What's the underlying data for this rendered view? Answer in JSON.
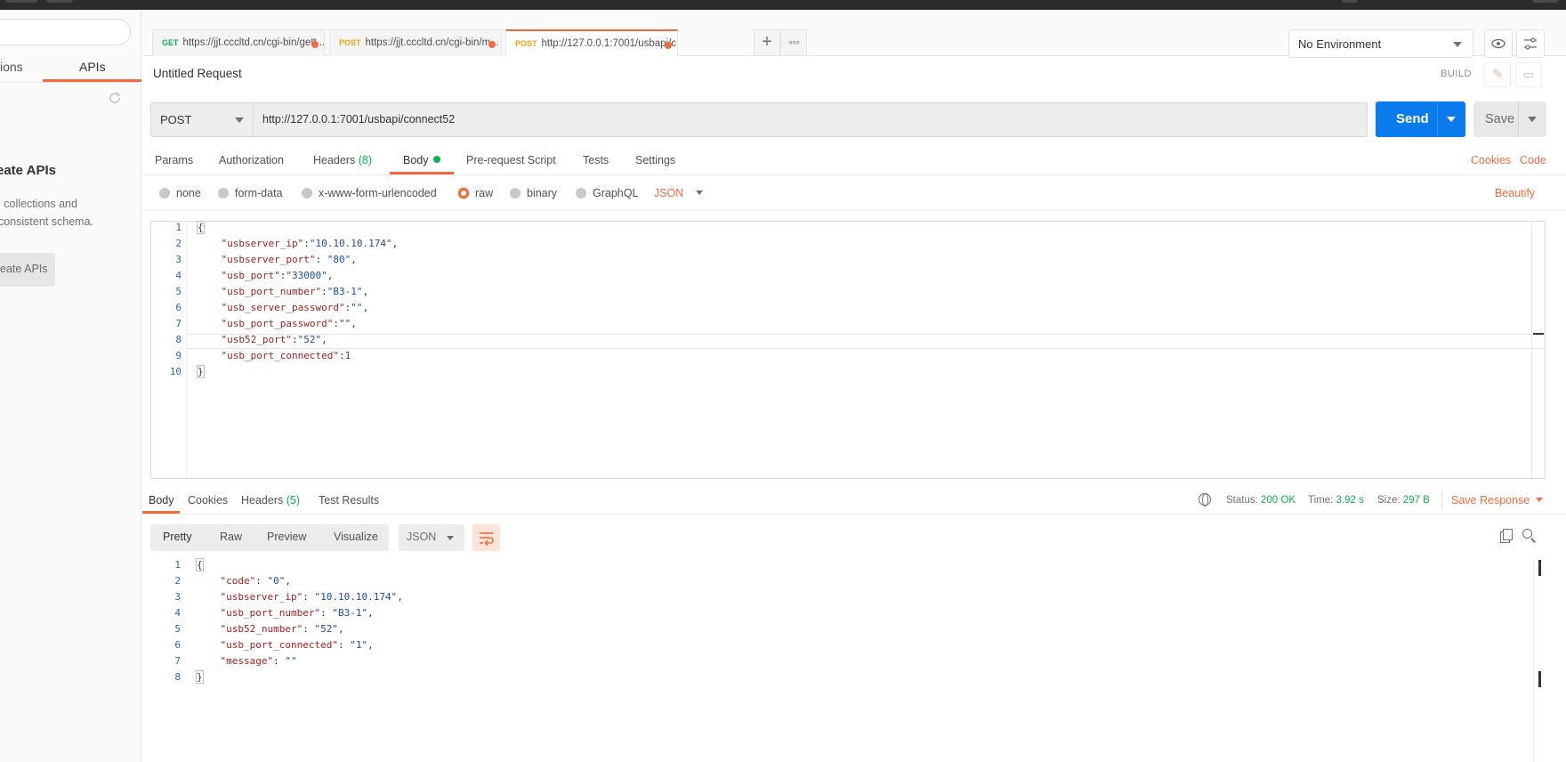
{
  "sidebar": {
    "tab_collections": "ions",
    "tab_apis": "APIs",
    "heading": "eate APIs",
    "desc_line1": "l collections and",
    "desc_line2": "consistent schema.",
    "button": "eate APIs"
  },
  "tabs": [
    {
      "method": "GET",
      "url": "https://jjt.cccltd.cn/cgi-bin/gett..."
    },
    {
      "method": "POST",
      "url": "https://jjt.cccltd.cn/cgi-bin/m..."
    },
    {
      "method": "POST",
      "url": "http://127.0.0.1:7001/usbapi/c..."
    }
  ],
  "environment": "No Environment",
  "request": {
    "title": "Untitled Request",
    "build_label": "BUILD",
    "method": "POST",
    "url": "http://127.0.0.1:7001/usbapi/connect52",
    "send_label": "Send",
    "save_label": "Save"
  },
  "request_tabs": {
    "params": "Params",
    "authorization": "Authorization",
    "headers": "Headers",
    "headers_count": "(8)",
    "body": "Body",
    "prerequest": "Pre-request Script",
    "tests": "Tests",
    "settings": "Settings",
    "cookies": "Cookies",
    "code": "Code"
  },
  "body_options": {
    "none": "none",
    "form_data": "form-data",
    "urlencoded": "x-www-form-urlencoded",
    "raw": "raw",
    "binary": "binary",
    "graphql": "GraphQL",
    "format": "JSON",
    "beautify": "Beautify"
  },
  "request_body": [
    {
      "ln": "1",
      "indent": "",
      "key": "",
      "sep": "",
      "val": "",
      "end": "",
      "brace": "{"
    },
    {
      "ln": "2",
      "indent": "    ",
      "key": "\"usbserver_ip\"",
      "sep": ":",
      "val": "\"10.10.10.174\"",
      "end": ",",
      "brace": ""
    },
    {
      "ln": "3",
      "indent": "    ",
      "key": "\"usbserver_port\"",
      "sep": ": ",
      "val": "\"80\"",
      "end": ",",
      "brace": ""
    },
    {
      "ln": "4",
      "indent": "    ",
      "key": "\"usb_port\"",
      "sep": ":",
      "val": "\"33000\"",
      "end": ",",
      "brace": ""
    },
    {
      "ln": "5",
      "indent": "    ",
      "key": "\"usb_port_number\"",
      "sep": ":",
      "val": "\"B3-1\"",
      "end": ",",
      "brace": ""
    },
    {
      "ln": "6",
      "indent": "    ",
      "key": "\"usb_server_password\"",
      "sep": ":",
      "val": "\"\"",
      "end": ",",
      "brace": ""
    },
    {
      "ln": "7",
      "indent": "    ",
      "key": "\"usb_port_password\"",
      "sep": ":",
      "val": "\"\"",
      "end": ",",
      "brace": ""
    },
    {
      "ln": "8",
      "indent": "    ",
      "key": "\"usb52_port\"",
      "sep": ":",
      "val": "\"52\"",
      "end": ",",
      "brace": ""
    },
    {
      "ln": "9",
      "indent": "    ",
      "key": "\"usb_port_connected\"",
      "sep": ":",
      "val": "1",
      "end": "",
      "brace": ""
    },
    {
      "ln": "10",
      "indent": "",
      "key": "",
      "sep": "",
      "val": "",
      "end": "",
      "brace": "}"
    }
  ],
  "response_tabs": {
    "body": "Body",
    "cookies": "Cookies",
    "headers": "Headers",
    "headers_count": "(5)",
    "test_results": "Test Results"
  },
  "response_stats": {
    "status_label": "Status:",
    "status_value": "200 OK",
    "time_label": "Time:",
    "time_value": "3.92 s",
    "size_label": "Size:",
    "size_value": "297 B",
    "save_response": "Save Response"
  },
  "response_view": {
    "pretty": "Pretty",
    "raw": "Raw",
    "preview": "Preview",
    "visualize": "Visualize",
    "format": "JSON"
  },
  "response_body": [
    {
      "ln": "1",
      "indent": "",
      "key": "",
      "sep": "",
      "val": "",
      "end": "",
      "brace": "{"
    },
    {
      "ln": "2",
      "indent": "    ",
      "key": "\"code\"",
      "sep": ": ",
      "val": "\"0\"",
      "end": ",",
      "brace": ""
    },
    {
      "ln": "3",
      "indent": "    ",
      "key": "\"usbserver_ip\"",
      "sep": ": ",
      "val": "\"10.10.10.174\"",
      "end": ",",
      "brace": ""
    },
    {
      "ln": "4",
      "indent": "    ",
      "key": "\"usb_port_number\"",
      "sep": ": ",
      "val": "\"B3-1\"",
      "end": ",",
      "brace": ""
    },
    {
      "ln": "5",
      "indent": "    ",
      "key": "\"usb52_number\"",
      "sep": ": ",
      "val": "\"52\"",
      "end": ",",
      "brace": ""
    },
    {
      "ln": "6",
      "indent": "    ",
      "key": "\"usb_port_connected\"",
      "sep": ": ",
      "val": "\"1\"",
      "end": ",",
      "brace": ""
    },
    {
      "ln": "7",
      "indent": "    ",
      "key": "\"message\"",
      "sep": ": ",
      "val": "\"\"",
      "end": "",
      "brace": ""
    },
    {
      "ln": "8",
      "indent": "",
      "key": "",
      "sep": "",
      "val": "",
      "end": "",
      "brace": "}"
    }
  ],
  "colors": {
    "accent": "#f26b3a",
    "send": "#097bed",
    "success": "#0cb54a"
  }
}
